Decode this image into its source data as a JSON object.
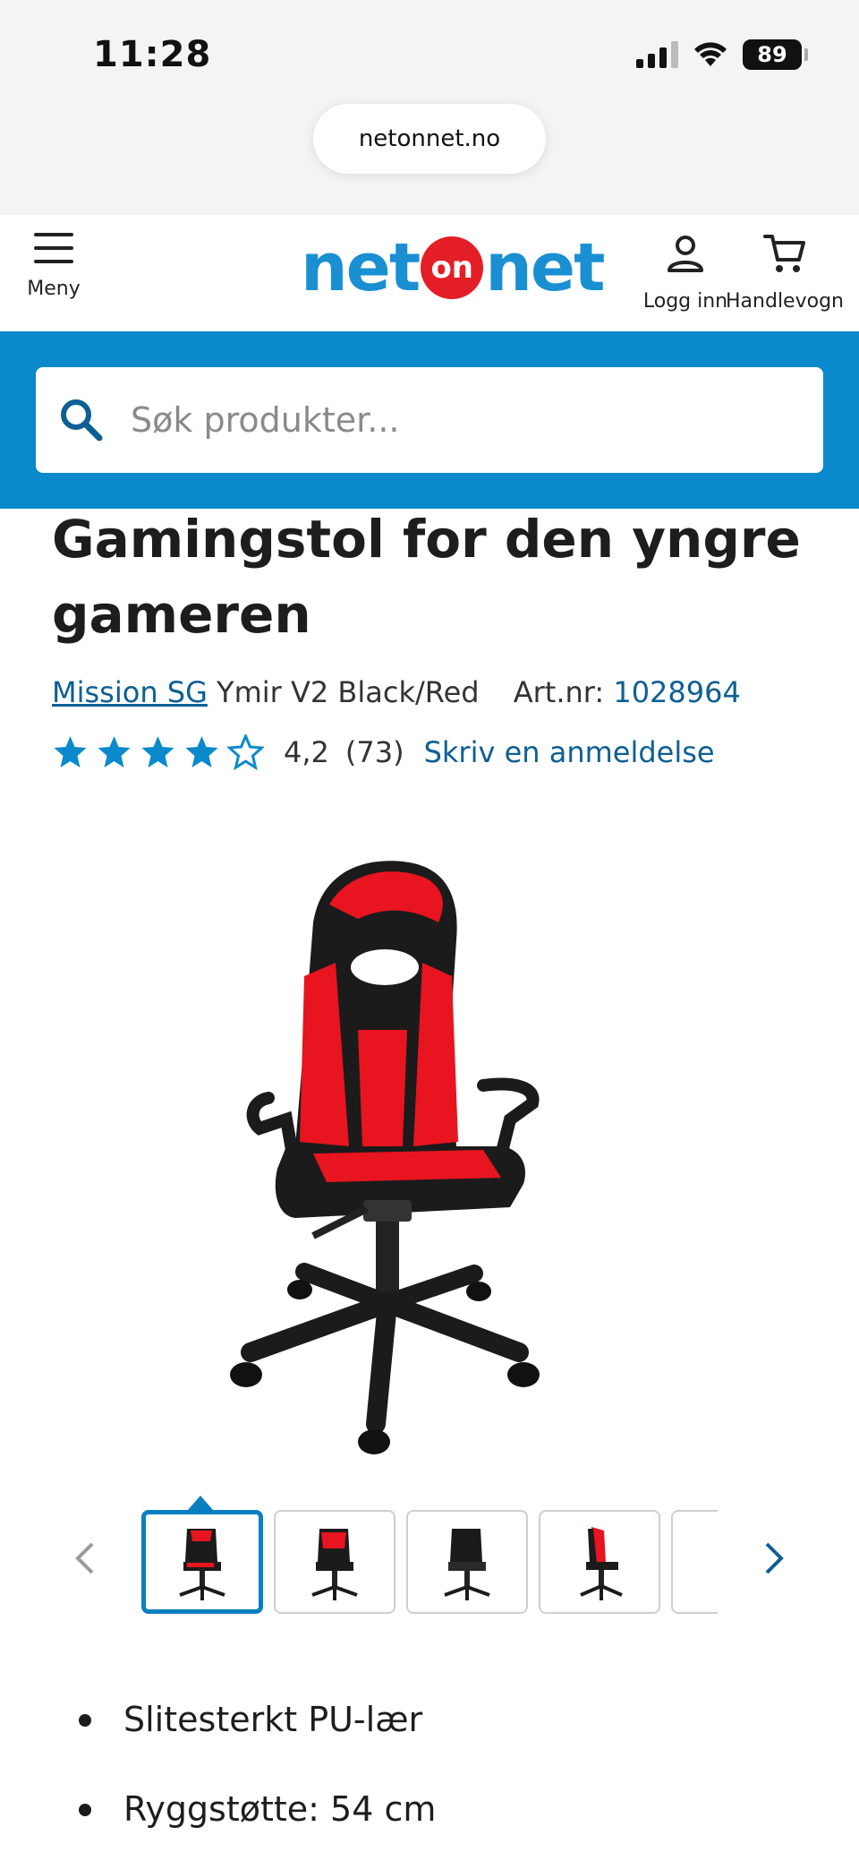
{
  "status_bar": {
    "time": "11:28",
    "battery": "89"
  },
  "browser": {
    "url": "netonnet.no"
  },
  "header": {
    "menu_label": "Meny",
    "logo": {
      "left": "net",
      "middle": "on",
      "right": "net"
    },
    "login_label": "Logg inn",
    "cart_label": "Handlevogn"
  },
  "search": {
    "placeholder": "Søk produkter..."
  },
  "product": {
    "title": "Gamingstol for den yngre gameren",
    "brand": "Mission SG",
    "model": "Ymir V2 Black/Red",
    "art_label": "Art.nr:",
    "art_number": "1028964",
    "rating_value": "4,2",
    "rating_count": "(73)",
    "write_review": "Skriv en anmeldelse",
    "stars_filled": 4,
    "stars_total": 5
  },
  "gallery": {
    "thumb_count_visible": 5,
    "active_index": 0
  },
  "features": [
    "Slitesterkt PU-lær",
    "Ryggstøtte: 54 cm"
  ],
  "colors": {
    "brand_blue": "#1a8fd2",
    "band_blue": "#0a8acb",
    "link_blue": "#0d5f94",
    "brand_red": "#e41e26"
  }
}
